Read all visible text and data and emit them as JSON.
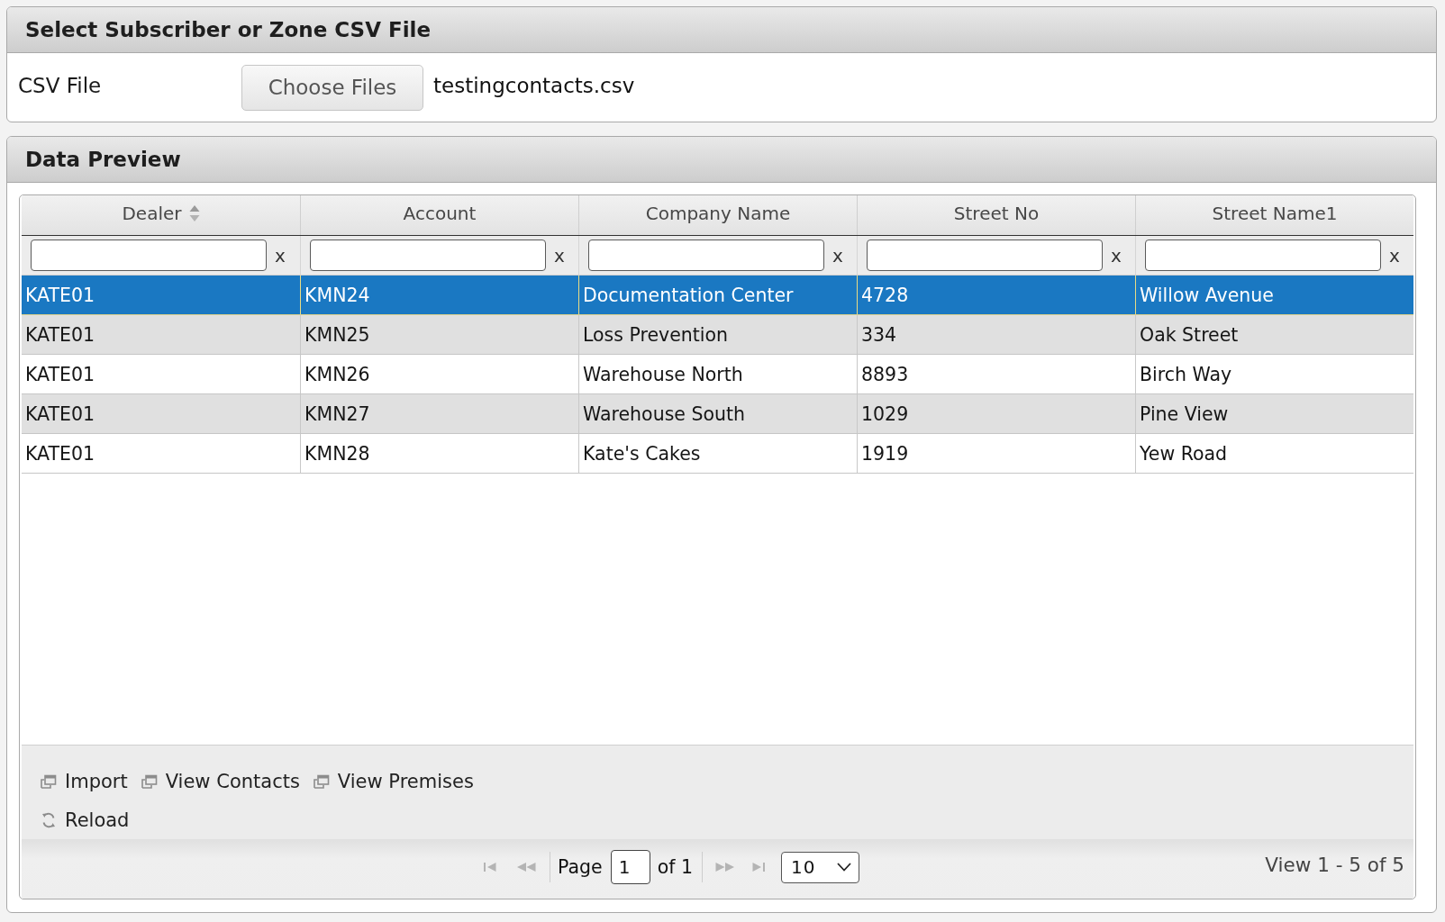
{
  "file_panel": {
    "title": "Select Subscriber or Zone CSV File",
    "field_label": "CSV File",
    "choose_button": "Choose Files",
    "file_name": "testingcontacts.csv"
  },
  "preview_panel": {
    "title": "Data Preview",
    "table": {
      "columns": [
        {
          "label": "Dealer",
          "sorted": true,
          "clear": "x"
        },
        {
          "label": "Account",
          "sorted": false,
          "clear": "x"
        },
        {
          "label": "Company Name",
          "sorted": false,
          "clear": "x"
        },
        {
          "label": "Street No",
          "sorted": false,
          "clear": "x"
        },
        {
          "label": "Street Name1",
          "sorted": false,
          "clear": "x"
        }
      ],
      "rows": [
        {
          "selected": true,
          "cells": [
            "KATE01",
            "KMN24",
            "Documentation Center",
            "4728",
            "Willow Avenue"
          ]
        },
        {
          "selected": false,
          "cells": [
            "KATE01",
            "KMN25",
            "Loss Prevention",
            "334",
            "Oak Street"
          ]
        },
        {
          "selected": false,
          "cells": [
            "KATE01",
            "KMN26",
            "Warehouse North",
            "8893",
            "Birch Way"
          ]
        },
        {
          "selected": false,
          "cells": [
            "KATE01",
            "KMN27",
            "Warehouse South",
            "1029",
            "Pine View"
          ]
        },
        {
          "selected": false,
          "cells": [
            "KATE01",
            "KMN28",
            "Kate's Cakes",
            "1919",
            "Yew Road"
          ]
        }
      ]
    },
    "toolbar": [
      {
        "actions": [
          {
            "kind": "window",
            "label": "Import"
          },
          {
            "kind": "window",
            "label": "View Contacts"
          },
          {
            "kind": "window",
            "label": "View Premises"
          }
        ]
      },
      {
        "actions": [
          {
            "kind": "reload",
            "label": "Reload"
          }
        ]
      }
    ],
    "pager": {
      "nav_before": [
        {
          "kind": "first",
          "disabled": true
        },
        {
          "kind": "prev",
          "disabled": true
        }
      ],
      "page_label": "Page",
      "page_value": "1",
      "page_total": "of 1",
      "nav_after": [
        {
          "kind": "next",
          "disabled": true
        },
        {
          "kind": "last",
          "disabled": true
        }
      ],
      "page_size": "10",
      "record_info": "View 1 - 5 of 5"
    }
  }
}
